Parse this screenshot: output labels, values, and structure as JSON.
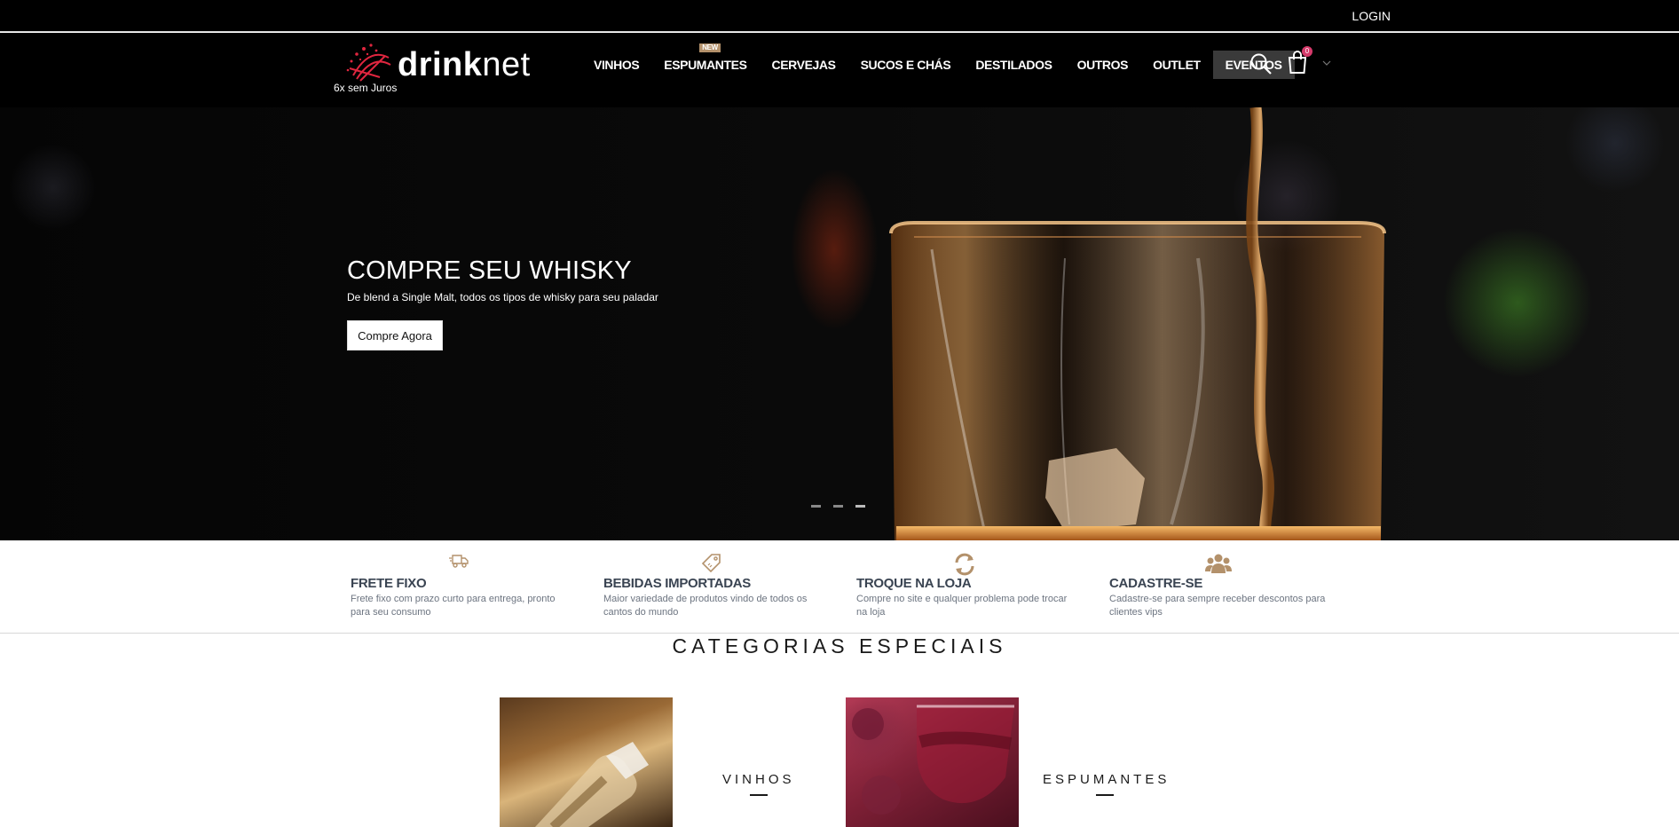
{
  "topbar": {
    "login_label": "LOGIN"
  },
  "header": {
    "logo": {
      "text_bold": "drink",
      "text_light": "net",
      "subtitle": "6x sem Juros",
      "mark_color": "#e0263f"
    },
    "nav": [
      {
        "label": "VINHOS"
      },
      {
        "label": "ESPUMANTES",
        "badge": "NEW"
      },
      {
        "label": "CERVEJAS"
      },
      {
        "label": "SUCOS E CHÁS"
      },
      {
        "label": "DESTILADOS"
      },
      {
        "label": "OUTROS"
      },
      {
        "label": "OUTLET"
      },
      {
        "label": "EVENTOS",
        "active": true
      }
    ],
    "cart_count": "0",
    "icons": [
      "search-icon",
      "cart-icon",
      "chevron-down-icon"
    ]
  },
  "hero": {
    "title": "COMPRE SEU WHISKY",
    "subtitle": "De blend a Single Malt, todos os tipos de whisky para seu paladar",
    "button_label": "Compre Agora",
    "slides_count": 3,
    "active_slide": 3
  },
  "features": [
    {
      "icon": "truck-icon",
      "title": "FRETE FIXO",
      "description": "Frete fixo com prazo curto para entrega, pronto para seu consumo"
    },
    {
      "icon": "tag-icon",
      "title": "BEBIDAS IMPORTADAS",
      "description": "Maior variedade de produtos vindo de todos os cantos do mundo"
    },
    {
      "icon": "refresh-icon",
      "title": "TROQUE NA LOJA",
      "description": "Compre no site e qualquer problema pode trocar na loja"
    },
    {
      "icon": "users-icon",
      "title": "CADASTRE-SE",
      "description": "Cadastre-se para sempre receber descontos para clientes vips"
    }
  ],
  "colors": {
    "accent": "#b3916b",
    "feature_title": "#3a4452",
    "cart_badge": "#d63a6b"
  },
  "categories": {
    "heading": "CATEGORIAS ESPECIAIS",
    "items": [
      {
        "label": "VINHOS"
      },
      {
        "label": "ESPUMANTES"
      }
    ]
  }
}
